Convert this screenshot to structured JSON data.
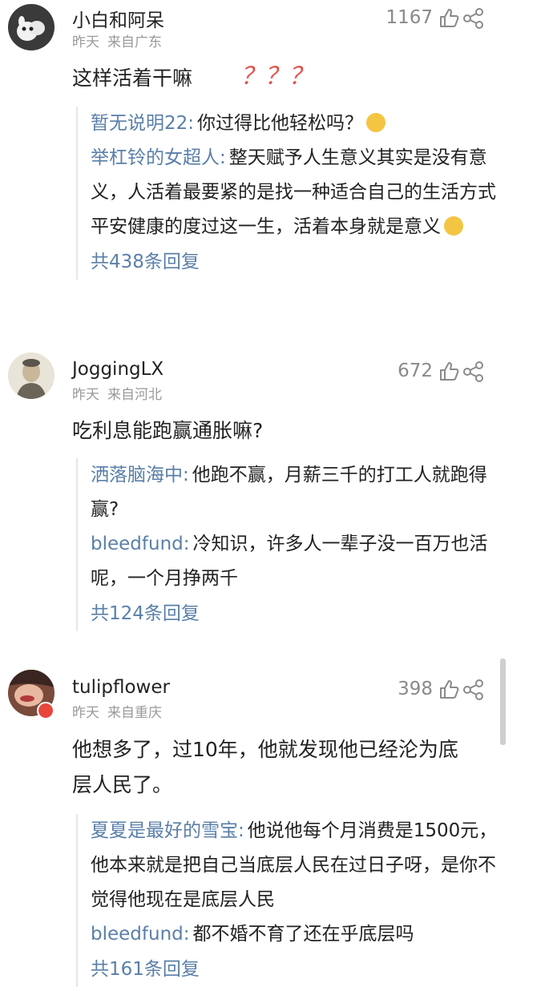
{
  "comments": [
    {
      "user": "小白和阿呆",
      "time": "昨天",
      "location": "来自广东",
      "likes": "1167",
      "text": "这样活着干嘛",
      "decoration": "？？？",
      "replies": [
        {
          "user": "暂无说明22",
          "text": "你过得比他轻松吗？"
        },
        {
          "user": "举杠铃的女超人",
          "text": "整天赋予人生意义其实是没有意义，人活着最要紧的是找一种适合自己的生活方式平安健康的度过这一生，活着本身就是意义"
        }
      ],
      "more": "共438条回复"
    },
    {
      "user": "JoggingLX",
      "time": "昨天",
      "location": "来自河北",
      "likes": "672",
      "text": "吃利息能跑赢通胀嘛?",
      "replies": [
        {
          "user": "洒落脑海中",
          "text": "他跑不赢，月薪三千的打工人就跑得赢?"
        },
        {
          "user": "bleedfund",
          "text": "冷知识，许多人一辈子没一百万也活呢，一个月挣两千"
        }
      ],
      "more": "共124条回复"
    },
    {
      "user": "tulipflower",
      "time": "昨天",
      "location": "来自重庆",
      "likes": "398",
      "text": "他想多了，过10年，他就发现他已经沦为底层人民了。",
      "replies": [
        {
          "user": "夏夏是最好的雪宝",
          "text": "他说他每个月消费是1500元，他本来就是把自己当底层人民在过日子呀，是你不觉得他现在是底层人民"
        },
        {
          "user": "bleedfund",
          "text": "都不婚不育了还在乎底层吗"
        }
      ],
      "more": "共161条回复"
    }
  ],
  "icons": {
    "like": "thumbs-up-icon",
    "share": "share-icon",
    "emoji_laugh": "laughing-emoji-icon",
    "emoji_cry": "crying-emoji-icon"
  },
  "colors": {
    "reply_user": "#5a7fa8",
    "meta": "#9a9a9a",
    "decoration": "#e0524a"
  }
}
